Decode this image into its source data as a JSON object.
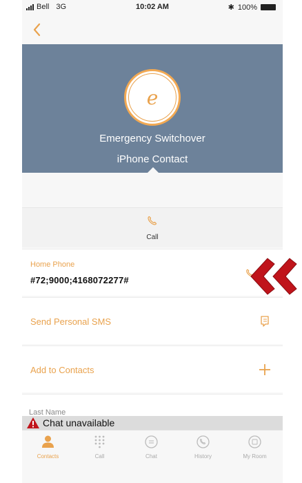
{
  "status_bar": {
    "carrier": "Bell",
    "network": "3G",
    "time": "10:02 AM",
    "battery": "100%"
  },
  "contact": {
    "initial": "e",
    "name": "Emergency Switchover",
    "subtitle": "iPhone Contact"
  },
  "call_action": {
    "label": "Call"
  },
  "fields": {
    "home_phone_label": "Home Phone",
    "home_phone_value": "#72;9000;4168072277#",
    "send_sms_label": "Send Personal SMS",
    "add_contacts_label": "Add to Contacts",
    "last_name_label": "Last Name"
  },
  "banner": {
    "text": "Chat unavailable"
  },
  "tabs": [
    {
      "label": "Contacts",
      "icon": "contacts-icon",
      "active": true
    },
    {
      "label": "Call",
      "icon": "dialpad-icon",
      "active": false
    },
    {
      "label": "Chat",
      "icon": "chat-icon",
      "active": false
    },
    {
      "label": "History",
      "icon": "history-icon",
      "active": false
    },
    {
      "label": "My Room",
      "icon": "room-icon",
      "active": false
    }
  ],
  "colors": {
    "accent": "#e9a24d",
    "header_bg": "#6d829a",
    "annotation": "#c0141b"
  }
}
